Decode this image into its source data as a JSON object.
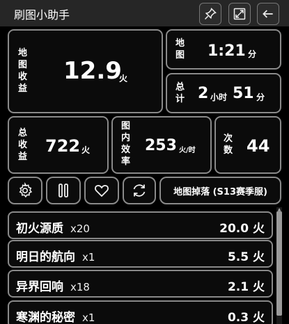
{
  "app": {
    "title": "刷图小助手"
  },
  "titlebar": {
    "pin_icon": "pin-icon",
    "resize_icon": "resize-icon",
    "back_icon": "back-arrow-icon"
  },
  "stats": {
    "map_income": {
      "label": "地图收益",
      "value": "12.9",
      "unit": "火"
    },
    "map_time": {
      "label": "地图",
      "value": "1:21",
      "unit": "分"
    },
    "total_time": {
      "label": "总计",
      "hours": "2",
      "hours_unit": "小时",
      "minutes": "51",
      "minutes_unit": "分"
    },
    "total_income": {
      "label": "总收益",
      "value": "722",
      "unit": "火"
    },
    "map_efficiency": {
      "label": "图内效率",
      "value": "253",
      "unit": "火/时"
    },
    "count": {
      "label": "次数",
      "value": "44"
    }
  },
  "toolbar": {
    "settings_icon": "gear-icon",
    "pause_icon": "pause-icon",
    "favorite_icon": "heart-icon",
    "refresh_icon": "refresh-icon",
    "drop_button_label": "地图掉落 (S13赛季服)"
  },
  "drops": [
    {
      "name": "初火源质",
      "qty": "x20",
      "value": "20.0 火"
    },
    {
      "name": "明日的航向",
      "qty": "x1",
      "value": "5.5 火"
    },
    {
      "name": "异界回响",
      "qty": "x18",
      "value": "2.1 火"
    },
    {
      "name": "寒渊的秘密",
      "qty": "x1",
      "value": "0.3 火"
    }
  ]
}
